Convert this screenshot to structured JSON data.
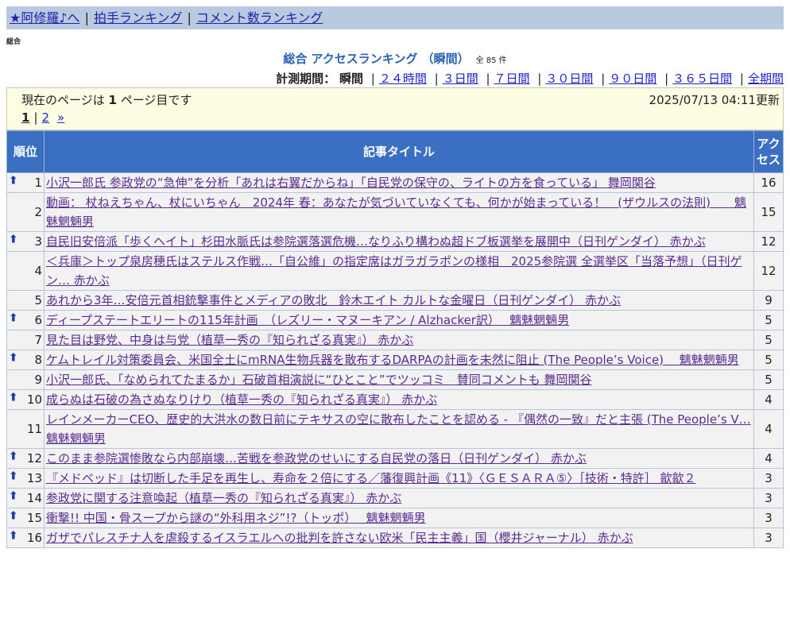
{
  "nav": {
    "home": "★阿修羅♪へ",
    "clap": "拍手ランキング",
    "comment": "コメント数ランキング"
  },
  "category": "総合",
  "heading": {
    "title": "総合 アクセスランキング （瞬間）",
    "count": "全 85 件"
  },
  "periods": {
    "label": "計測期間：",
    "current": "瞬間",
    "links": [
      "２４時間",
      "３日間",
      "７日間",
      "３０日間",
      "９０日間",
      "３６５日間",
      "全期間"
    ]
  },
  "info": {
    "page_prefix": "現在のページは",
    "page_num": "1",
    "page_suffix": "ページ目です",
    "updated": "2025/07/13 04:11更新"
  },
  "pager": {
    "current": "1",
    "next_page": "2",
    "next": "»"
  },
  "table": {
    "headers": {
      "rank": "順位",
      "title": "記事タイトル",
      "access": "アクセス"
    },
    "rows": [
      {
        "rank": "1",
        "up": true,
        "title": "小沢一郎氏 参政党の“急伸”を分析「あれは右翼だからね」「自民党の保守の、ライトの方を食っている」 舞岡関谷",
        "access": "16"
      },
      {
        "rank": "2",
        "up": false,
        "title": "動画： 杖ねえちゃん、杖にいちゃん　2024年 春：あなたが気づいていなくても、何かが始まっている！　(ザウルスの法則)　　魑魅魍魎男",
        "access": "15"
      },
      {
        "rank": "3",
        "up": true,
        "title": "自民旧安倍派「歩くヘイト」杉田水脈氏は参院選落選危機…なりふり構わぬ超ドブ板選挙を展開中（日刊ゲンダイ） 赤かぶ",
        "access": "12"
      },
      {
        "rank": "4",
        "up": false,
        "title": "＜兵庫＞トップ泉房穂氏はステルス作戦…「自公維」の指定席はガラガラポンの様相　2025参院選 全選挙区「当落予想」（日刊ゲン… 赤かぶ",
        "access": "12"
      },
      {
        "rank": "5",
        "up": false,
        "title": "あれから3年…安倍元首相銃撃事件とメディアの敗北　鈴木エイト カルトな金曜日（日刊ゲンダイ） 赤かぶ",
        "access": "9"
      },
      {
        "rank": "6",
        "up": true,
        "title": "ディープステートエリートの115年計画　（レズリー・マヌーキアン / Alzhacker訳）　 魑魅魍魎男",
        "access": "5"
      },
      {
        "rank": "7",
        "up": false,
        "title": "見た目は野党、中身は与党（植草一秀の『知られざる真実』） 赤かぶ",
        "access": "5"
      },
      {
        "rank": "8",
        "up": true,
        "title": "ケムトレイル対策委員会、米国全土にmRNA生物兵器を散布するDARPAの計画を未然に阻止 (The People’s Voice)　 魑魅魍魎男",
        "access": "5"
      },
      {
        "rank": "9",
        "up": false,
        "title": "小沢一郎氏、「なめられてたまるか」石破首相演説に“ひとこと”でツッコミ　賛同コメントも 舞岡関谷",
        "access": "5"
      },
      {
        "rank": "10",
        "up": true,
        "title": "成らぬは石破の為さぬなりけり（植草一秀の『知られざる真実』） 赤かぶ",
        "access": "4"
      },
      {
        "rank": "11",
        "up": false,
        "title": "レインメーカーCEO、歴史的大洪水の数日前にテキサスの空に散布したことを認める - 『偶然の一致』だと主張 (The People’s V… 魑魅魍魎男",
        "access": "4"
      },
      {
        "rank": "12",
        "up": true,
        "title": "このまま参院選惨敗なら内部崩壊…苦戦を参政党のせいにする自民党の落日（日刊ゲンダイ） 赤かぶ",
        "access": "4"
      },
      {
        "rank": "13",
        "up": true,
        "title": "『メドベッド』は切断した手足を再生し、寿命を２倍にする／藩復興計画《11》〈ＧＥＳＡＲＡ⑤〉［技術・特許］ 歙歙２",
        "access": "3"
      },
      {
        "rank": "14",
        "up": true,
        "title": "参政党に関する注意喚起（植草一秀の『知られざる真実』） 赤かぶ",
        "access": "3"
      },
      {
        "rank": "15",
        "up": true,
        "title": "衝撃!! 中国・骨スープから謎の“外科用ネジ”!?（トッポ）　 魑魅魍魎男",
        "access": "3"
      },
      {
        "rank": "16",
        "up": true,
        "title": "ガザでパレスチナ人を虐殺するイスラエルへの批判を許さない欧米「民主主義」国（櫻井ジャーナル） 赤かぶ",
        "access": "3"
      }
    ]
  },
  "colors": {
    "header_bg": "#3a6fc2",
    "topbar_bg": "#b9c9df",
    "title_blue": "#2a62b8",
    "link_visited": "#5a2d90",
    "arrow": "#1a3fa8"
  },
  "icons": {
    "rising": "up-arrow-icon"
  }
}
